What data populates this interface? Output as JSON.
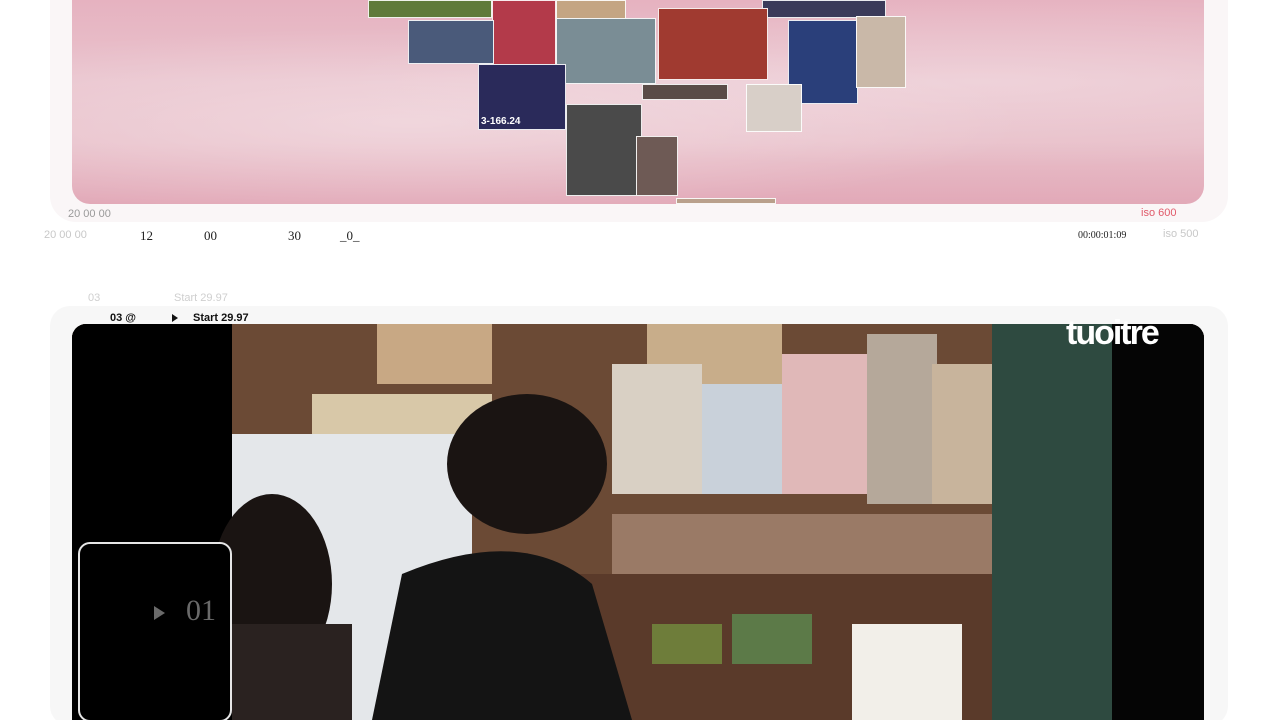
{
  "timeline": {
    "faint_row1": "20  00   00",
    "faint_row2": "20  00   00",
    "tick_12": "12",
    "tick_00": "00",
    "tick_30": "30",
    "tick_0": "_0_",
    "iso_active": "iso 600",
    "iso_faint": "iso 500",
    "timecode": "00:00:01:09"
  },
  "collage": {
    "thumbs": [
      {
        "label": "",
        "color": "#5f7a3a"
      },
      {
        "label": "",
        "color": "#b33a4a"
      },
      {
        "label": "",
        "color": "#4a5a7a"
      },
      {
        "label": "",
        "color": "#3b3b5a"
      },
      {
        "label": "",
        "color": "#c4a583"
      },
      {
        "label": "",
        "color": "#a03a30"
      },
      {
        "label": "",
        "color": "#7a8d95"
      },
      {
        "label": "",
        "color": "#5a4b47"
      },
      {
        "label": "",
        "color": "#2a3f7a"
      },
      {
        "label": "",
        "color": "#c9b8a8"
      },
      {
        "label": "3-166.24",
        "color": "#2a2a5a"
      },
      {
        "label": "",
        "color": "#4a4a4a"
      },
      {
        "label": "",
        "color": "#d8cfc8"
      },
      {
        "label": "",
        "color": "#6e5a55"
      },
      {
        "label": "",
        "color": "#b9a08c"
      }
    ]
  },
  "clip": {
    "number_faint": "03",
    "start_faint": "Start 29.97",
    "number": "03 @",
    "start": "Start 29.97",
    "preview_number": "01",
    "watermark": "tuoitre"
  }
}
